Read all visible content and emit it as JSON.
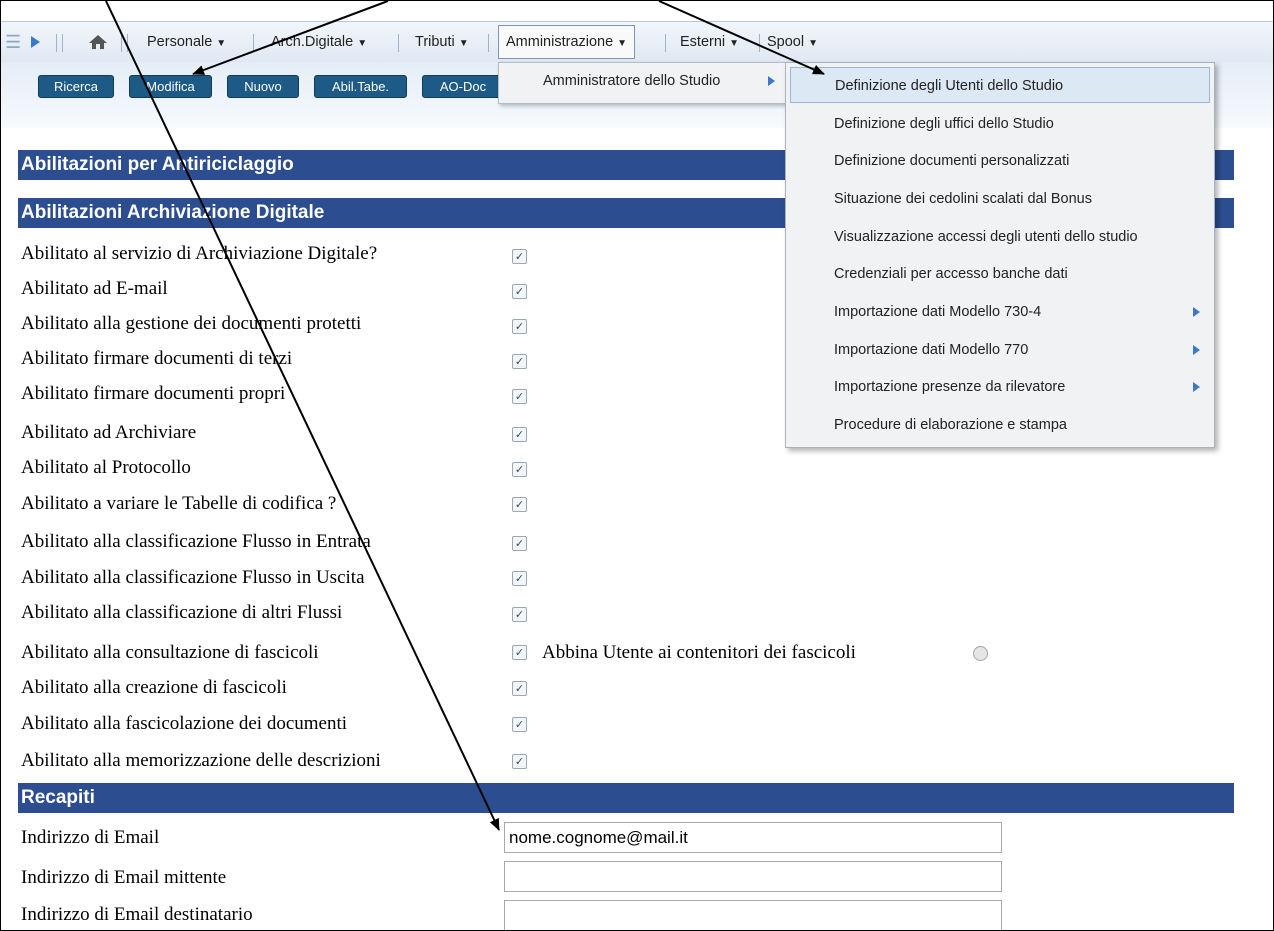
{
  "menubar": {
    "items": [
      {
        "label": "Personale"
      },
      {
        "label": "Arch.Digitale"
      },
      {
        "label": "Tributi"
      },
      {
        "label": "Amministrazione"
      },
      {
        "label": "Esterni"
      },
      {
        "label": "Spool"
      }
    ]
  },
  "toolbar": {
    "buttons": [
      {
        "label": "Ricerca"
      },
      {
        "label": "Modifica"
      },
      {
        "label": "Nuovo"
      },
      {
        "label": "Abil.Tabe."
      },
      {
        "label": "AO-Doc"
      }
    ]
  },
  "menu_amministrazione": {
    "items": [
      {
        "label": "Amministratore dello Studio"
      }
    ]
  },
  "menu_amministratore": {
    "items": [
      {
        "label": "Definizione degli Utenti dello Studio"
      },
      {
        "label": "Definizione degli uffici dello Studio"
      },
      {
        "label": "Definizione documenti personalizzati"
      },
      {
        "label": "Situazione dei cedolini scalati dal Bonus"
      },
      {
        "label": "Visualizzazione accessi degli utenti dello studio"
      },
      {
        "label": "Credenziali per accesso banche dati"
      },
      {
        "label": "Importazione dati Modello 730-4"
      },
      {
        "label": "Importazione dati Modello 770"
      },
      {
        "label": "Importazione presenze da rilevatore"
      },
      {
        "label": "Procedure di elaborazione e stampa"
      }
    ]
  },
  "sections": {
    "antiriciclaggio": "Abilitazioni per Antiriciclaggio",
    "archiviazione": "Abilitazioni Archiviazione Digitale",
    "recapiti": "Recapiti"
  },
  "permissions": [
    {
      "label": "Abilitato al servizio di Archiviazione Digitale?",
      "checked": true
    },
    {
      "label": "Abilitato ad E-mail",
      "checked": true
    },
    {
      "label": "Abilitato alla gestione dei documenti protetti",
      "checked": true
    },
    {
      "label": "Abilitato firmare documenti di terzi",
      "checked": true
    },
    {
      "label": "Abilitato firmare documenti propri",
      "checked": true
    },
    {
      "label": "Abilitato ad Archiviare",
      "checked": true
    },
    {
      "label": "Abilitato al Protocollo",
      "checked": true
    },
    {
      "label": "Abilitato a variare le Tabelle di codifica ?",
      "checked": true
    },
    {
      "label": "Abilitato alla classificazione Flusso in Entrata",
      "checked": true
    },
    {
      "label": "Abilitato alla classificazione Flusso in Uscita",
      "checked": true
    },
    {
      "label": "Abilitato alla classificazione di altri Flussi",
      "checked": true
    },
    {
      "label": "Abilitato alla consultazione di fascicoli",
      "checked": true
    },
    {
      "label": "Abilitato alla creazione di fascicoli",
      "checked": true
    },
    {
      "label": "Abilitato alla fascicolazione dei documenti",
      "checked": true
    },
    {
      "label": "Abilitato alla memorizzazione delle descrizioni",
      "checked": true
    }
  ],
  "abbina": {
    "label": "Abbina Utente ai contenitori dei fascicoli"
  },
  "recapiti": {
    "fields": [
      {
        "label": "Indirizzo di Email",
        "value": "nome.cognome@mail.it"
      },
      {
        "label": "Indirizzo di Email mittente",
        "value": ""
      },
      {
        "label": "Indirizzo di Email destinatario",
        "value": ""
      }
    ]
  }
}
